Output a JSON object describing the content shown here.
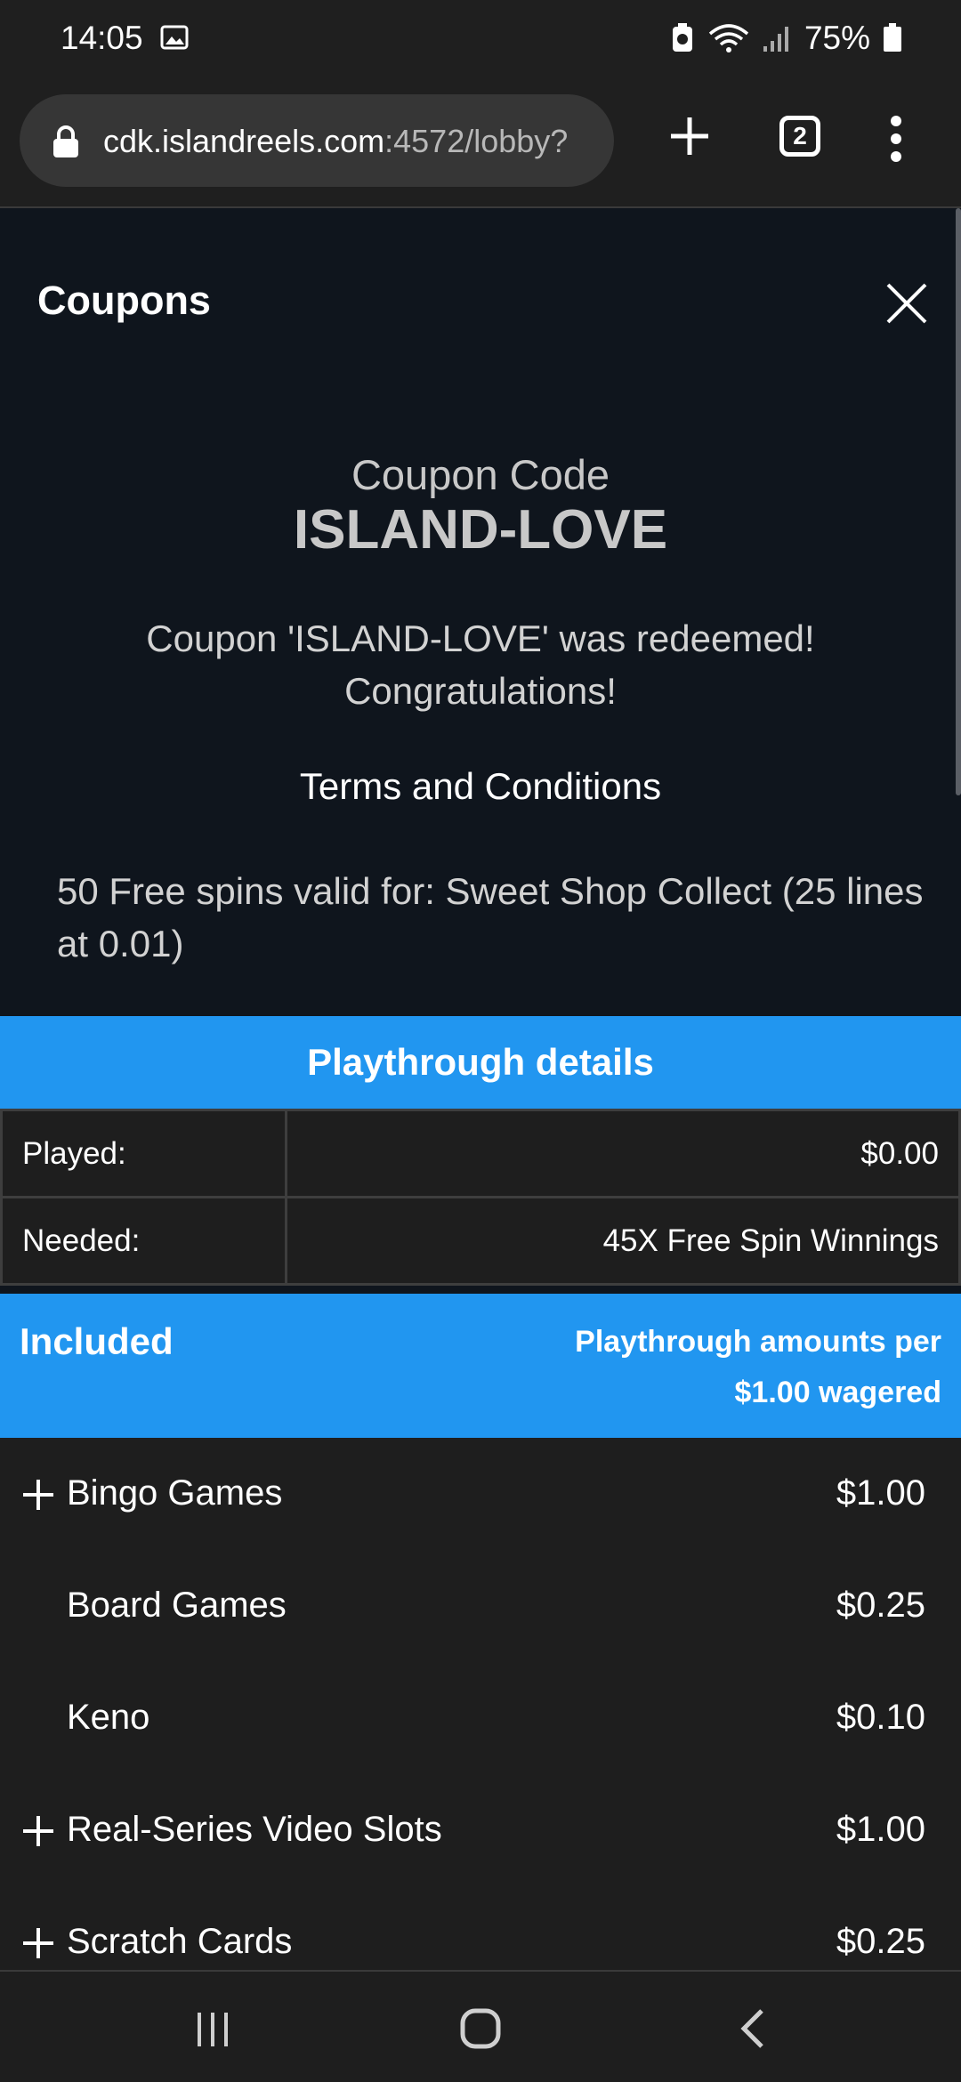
{
  "status_bar": {
    "time": "14:05",
    "battery": "75%"
  },
  "browser": {
    "url_host": "cdk.islandreels.com",
    "url_path": ":4572/lobby?",
    "tab_count": "2"
  },
  "modal": {
    "title": "Coupons",
    "coupon_label": "Coupon Code",
    "coupon_code": "ISLAND-LOVE",
    "redeem_line1": "Coupon 'ISLAND-LOVE' was redeemed!",
    "redeem_line2": "Congratulations!",
    "terms_heading": "Terms and Conditions",
    "terms_text": "50 Free spins valid for: Sweet Shop Collect (25 lines at 0.01)"
  },
  "playthrough": {
    "header": "Playthrough details",
    "rows": [
      {
        "label": "Played:",
        "value": "$0.00"
      },
      {
        "label": "Needed:",
        "value": "45X Free Spin Winnings"
      }
    ]
  },
  "included": {
    "title": "Included",
    "amount_line1": "Playthrough amounts per",
    "amount_line2": "$1.00 wagered",
    "games": [
      {
        "name": "Bingo Games",
        "amount": "$1.00",
        "expandable": true
      },
      {
        "name": "Board Games",
        "amount": "$0.25",
        "expandable": false
      },
      {
        "name": "Keno",
        "amount": "$0.10",
        "expandable": false
      },
      {
        "name": "Real-Series Video Slots",
        "amount": "$1.00",
        "expandable": true
      },
      {
        "name": "Scratch Cards",
        "amount": "$0.25",
        "expandable": true
      }
    ]
  }
}
